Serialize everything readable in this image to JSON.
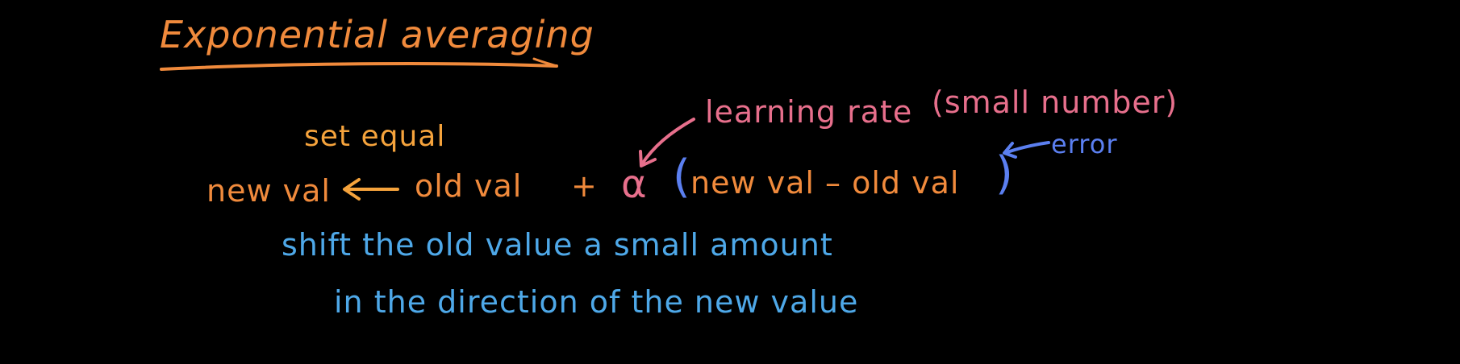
{
  "title": "Exponential averaging",
  "equation": {
    "set_label": "set equal",
    "lhs": "new val",
    "old_val": "old val",
    "plus": "+",
    "alpha": "α",
    "paren_open": "(",
    "paren_inner": "new val – old val",
    "paren_close": ")"
  },
  "annotations": {
    "learning_rate": "learning rate",
    "learning_rate_note": "(small number)",
    "error": "error"
  },
  "explanation": {
    "line1": "shift the old value  a small amount",
    "line2": "in the direction of the new value"
  },
  "colors": {
    "background": "#000000",
    "orange": "#f08a3c",
    "pink": "#e76f8c",
    "blue_paren": "#5b7ff0",
    "blue_text": "#4ea8e8"
  },
  "icons": {
    "assign_arrow": "left-arrow-icon",
    "learning_rate_pointer": "pointer-arrow-icon",
    "error_pointer": "pointer-arrow-icon"
  }
}
